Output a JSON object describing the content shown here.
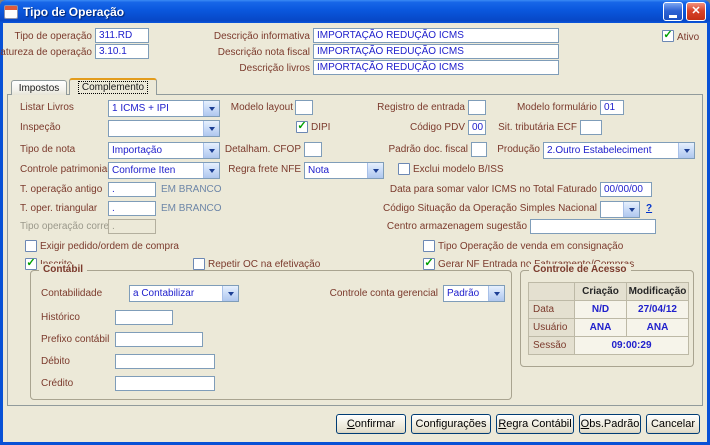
{
  "window": {
    "title": "Tipo de Operação"
  },
  "colors": {
    "label": "#7b3a2c",
    "value": "#2020cc",
    "check": "#00a000",
    "hint": "#6d86a8",
    "link": "#0033cc"
  },
  "icons": {
    "close_glyph": "✕"
  },
  "header": {
    "tipo_operacao": {
      "label": "Tipo de operação",
      "value": "311.RD"
    },
    "natureza_operacao": {
      "label": "Natureza de operação",
      "value": "3.10.1"
    },
    "descricao_informativa": {
      "label": "Descrição informativa",
      "value": "IMPORTAÇÃO REDUÇÃO ICMS"
    },
    "descricao_nota_fiscal": {
      "label": "Descrição nota fiscal",
      "value": "IMPORTAÇÃO REDUÇÃO ICMS"
    },
    "descricao_livros": {
      "label": "Descrição livros",
      "value": "IMPORTAÇÃO REDUÇÃO ICMS"
    },
    "ativo": {
      "label": "Ativo",
      "checked": true
    }
  },
  "tabs": [
    {
      "label": "Impostos",
      "active": false
    },
    {
      "label": "Complemento",
      "active": true
    }
  ],
  "form": {
    "listar_livros": {
      "label": "Listar Livros",
      "value": "1 ICMS + IPI"
    },
    "modelo_layout": {
      "label": "Modelo layout",
      "value": ""
    },
    "registro_entrada": {
      "label": "Registro de entrada",
      "value": ""
    },
    "modelo_formulario": {
      "label": "Modelo formulário",
      "value": "01"
    },
    "inspecao": {
      "label": "Inspeção",
      "value": ""
    },
    "dipi": {
      "label": "DIPI",
      "checked": true
    },
    "codigo_pdv": {
      "label": "Código PDV",
      "value": "00"
    },
    "sit_tributaria_ecf": {
      "label": "Sit. tributária ECF",
      "value": ""
    },
    "tipo_de_nota": {
      "label": "Tipo de nota",
      "value": "Importação"
    },
    "detalham_cfop": {
      "label": "Detalham. CFOP",
      "value": ""
    },
    "padrao_doc_fiscal": {
      "label": "Padrão doc. fiscal",
      "value": ""
    },
    "producao": {
      "label": "Produção",
      "value": "2.Outro Estabeleciment"
    },
    "controle_patrimonial": {
      "label": "Controle patrimonial",
      "value": "Conforme Iten"
    },
    "regra_frete_nfe": {
      "label": "Regra frete NFE",
      "value": "Nota"
    },
    "exclui_modelo_biss": {
      "label": "Exclui modelo B/ISS",
      "checked": false
    },
    "t_operacao_antigo": {
      "label": "T. operação antigo",
      "value": ".",
      "suffix": "EM BRANCO"
    },
    "data_somar_icms": {
      "label": "Data para somar valor ICMS no Total Faturado",
      "value": "00/00/00"
    },
    "t_oper_triangular": {
      "label": "T. oper. triangular",
      "value": ".",
      "suffix": "EM BRANCO"
    },
    "codigo_situacao_simples": {
      "label": "Código Situação da Operação Simples Nacional",
      "value": "",
      "help": "?"
    },
    "tipo_operacao_correl": {
      "label": "Tipo operação correl.",
      "value": "."
    },
    "centro_armazenagem": {
      "label": "Centro armazenagem sugestão",
      "value": ""
    },
    "exigir_pedido": {
      "label": "Exigir pedido/ordem de compra",
      "checked": false
    },
    "tipo_operacao_consignacao": {
      "label": "Tipo Operação de venda em consignação",
      "checked": false
    },
    "inscrito": {
      "label": "Inscrito",
      "checked": true
    },
    "repetir_oc": {
      "label": "Repetir OC na efetivação",
      "checked": false
    },
    "gerar_nf_entrada": {
      "label": "Gerar NF Entrada no Faturamento/Compras",
      "checked": true
    }
  },
  "contabil": {
    "title": "Contábil",
    "contabilidade": {
      "label": "Contabilidade",
      "value": "a Contabilizar"
    },
    "controle_conta_gerencial": {
      "label": "Controle conta gerencial",
      "value": "Padrão"
    },
    "historico": {
      "label": "Histórico",
      "value": ""
    },
    "prefixo_contabil": {
      "label": "Prefixo contábil",
      "value": ""
    },
    "debito": {
      "label": "Débito",
      "value": ""
    },
    "credito": {
      "label": "Crédito",
      "value": ""
    }
  },
  "acesso": {
    "title": "Controle de Acesso",
    "columns": {
      "criacao": "Criação",
      "modificacao": "Modificação"
    },
    "rows": [
      {
        "label": "Data",
        "criacao": "N/D",
        "modificacao": "27/04/12"
      },
      {
        "label": "Usuário",
        "criacao": "ANA",
        "modificacao": "ANA"
      }
    ],
    "sessao": {
      "label": "Sessão",
      "value": "09:00:29"
    }
  },
  "buttons": [
    {
      "label": "Confirmar"
    },
    {
      "label": "Configurações"
    },
    {
      "label": "Regra Contábil"
    },
    {
      "label": "Obs.Padrão"
    },
    {
      "label": "Cancelar"
    }
  ]
}
